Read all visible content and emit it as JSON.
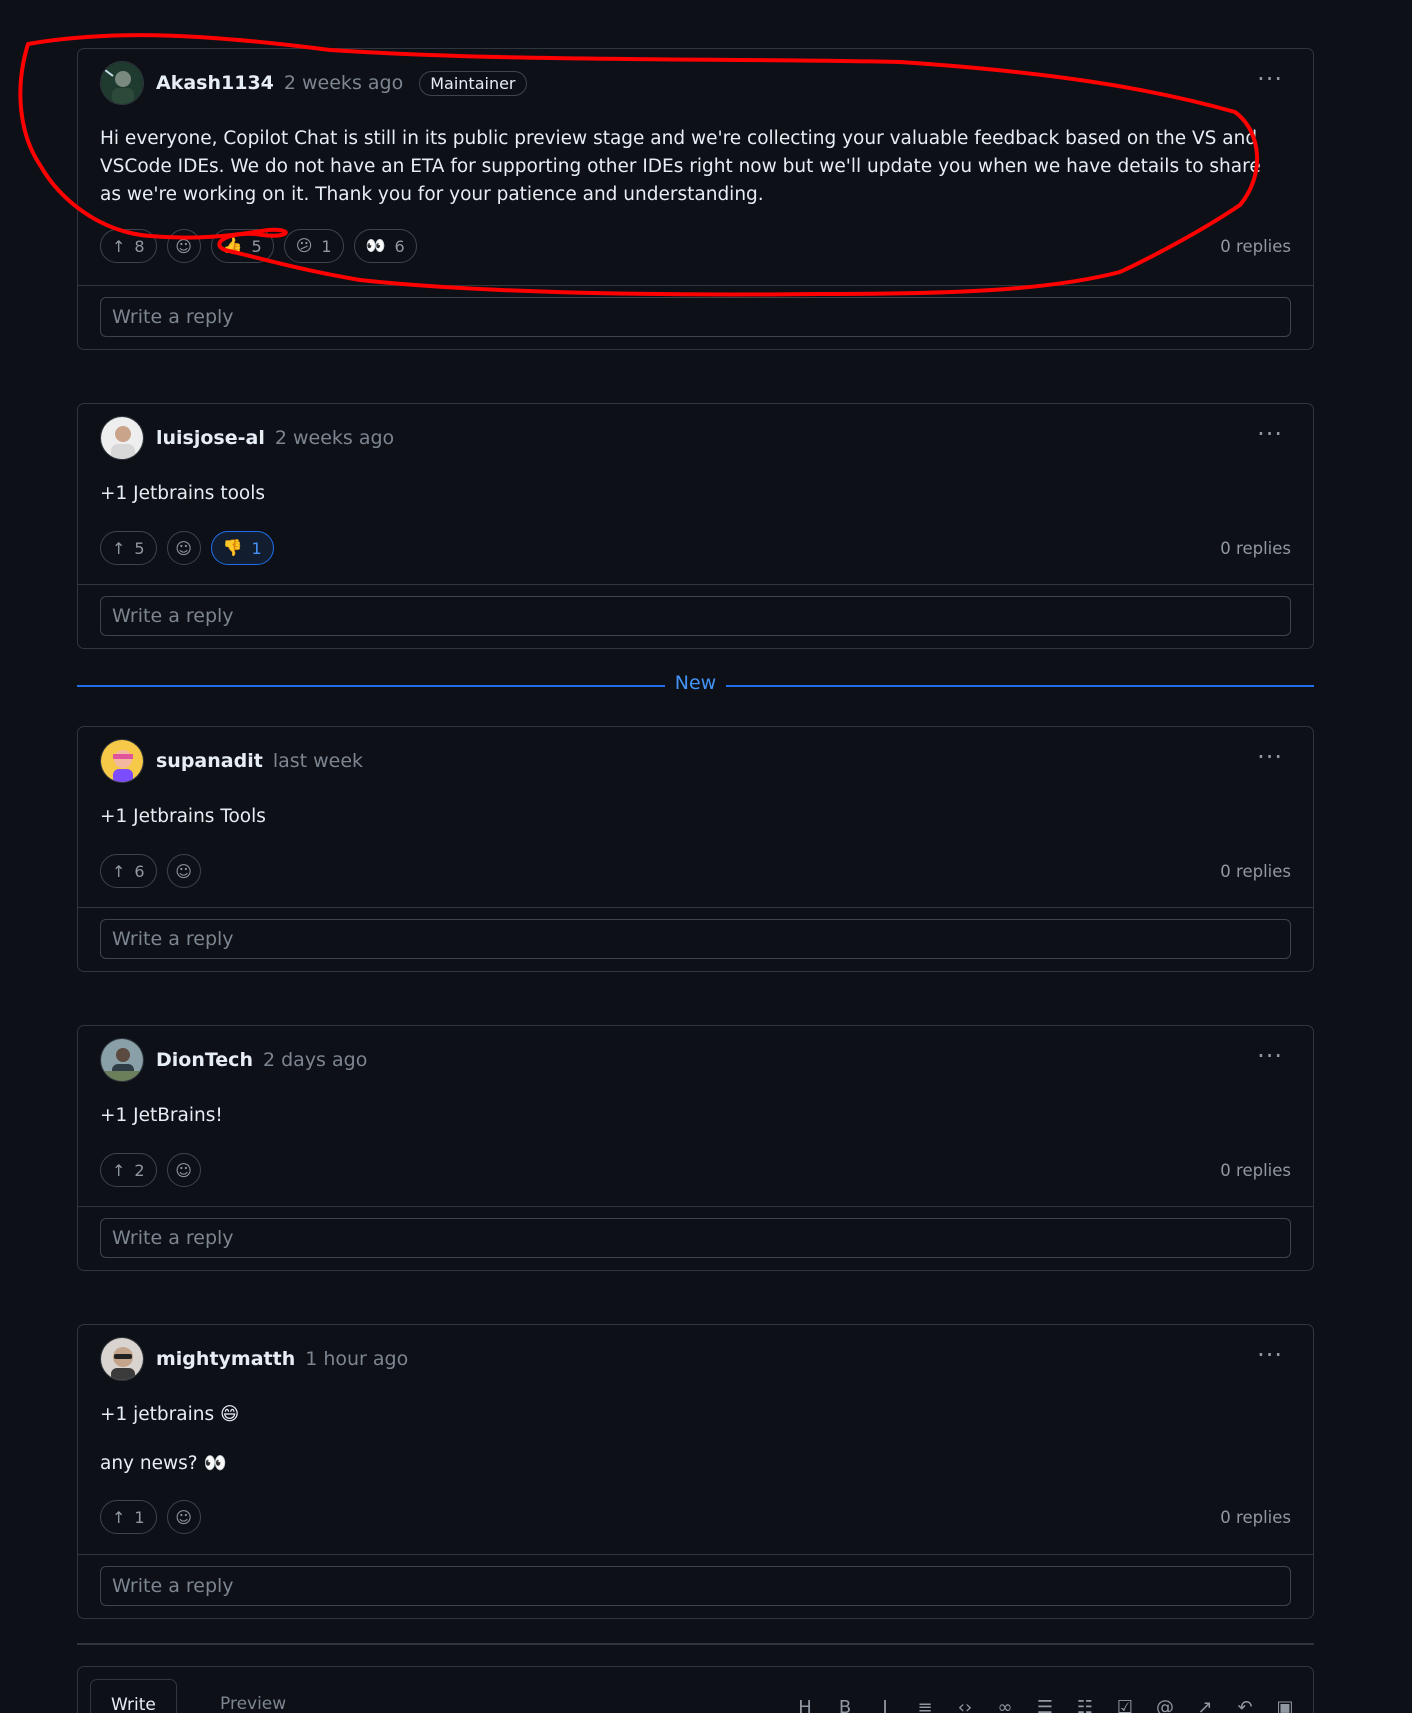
{
  "comments": [
    {
      "author": "Akash1134",
      "time": "2 weeks ago",
      "badge": "Maintainer",
      "text": [
        "Hi everyone, Copilot Chat is still in its public preview stage and we're collecting your valuable feedback based on the VS and VSCode IDEs. We do not have an ETA for supporting other IDEs right now but we'll update you when we have details to share as we're working on it. Thank you for your patience and understanding."
      ],
      "upvotes": "8",
      "reactions": [
        {
          "icon": "thumbs-up-emoji",
          "glyph": "👍",
          "count": "5"
        },
        {
          "icon": "confused-emoji",
          "glyph": "😕",
          "count": "1"
        },
        {
          "icon": "eyes-emoji",
          "glyph": "👀",
          "count": "6"
        }
      ],
      "replies": "0 replies",
      "reply_placeholder": "Write a reply"
    },
    {
      "author": "luisjose-al",
      "time": "2 weeks ago",
      "text": [
        "+1 Jetbrains tools"
      ],
      "upvotes": "5",
      "reactions": [
        {
          "icon": "thumbs-down-emoji",
          "glyph": "👎",
          "count": "1",
          "active": true
        }
      ],
      "replies": "0 replies",
      "reply_placeholder": "Write a reply"
    },
    {
      "author": "supanadit",
      "time": "last week",
      "text": [
        "+1 Jetbrains Tools"
      ],
      "upvotes": "6",
      "replies": "0 replies",
      "reply_placeholder": "Write a reply"
    },
    {
      "author": "DionTech",
      "time": "2 days ago",
      "text": [
        "+1 JetBrains!"
      ],
      "upvotes": "2",
      "replies": "0 replies",
      "reply_placeholder": "Write a reply"
    },
    {
      "author": "mightymatth",
      "time": "1 hour ago",
      "text": [
        "+1 jetbrains 😄",
        "any news? 👀"
      ],
      "upvotes": "1",
      "replies": "0 replies",
      "reply_placeholder": "Write a reply"
    }
  ],
  "new_divider": "New",
  "editor": {
    "write_tab": "Write",
    "preview_tab": "Preview"
  },
  "annotation_color": "#ff0000",
  "colors": {
    "background": "#0d1117",
    "border": "#30363d",
    "accent": "#4493f8"
  }
}
